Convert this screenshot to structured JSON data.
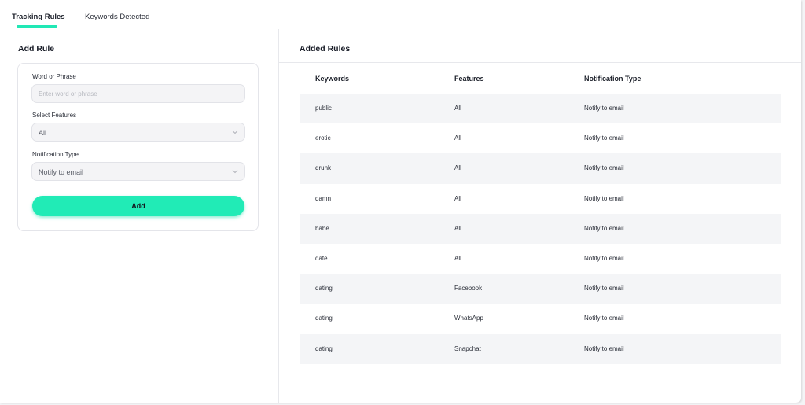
{
  "tabs": [
    {
      "label": "Tracking Rules",
      "active": true
    },
    {
      "label": "Keywords Detected",
      "active": false
    }
  ],
  "add_rule": {
    "title": "Add Rule",
    "word_label": "Word or Phrase",
    "word_placeholder": "Enter word or phrase",
    "word_value": "",
    "features_label": "Select Features",
    "features_value": "All",
    "notification_label": "Notification Type",
    "notification_value": "Notify to email",
    "add_button": "Add"
  },
  "added_rules": {
    "title": "Added Rules",
    "columns": [
      "Keywords",
      "Features",
      "Notification Type"
    ],
    "rows": [
      {
        "keyword": "public",
        "features": "All",
        "notification": "Notify to email"
      },
      {
        "keyword": "erotic",
        "features": "All",
        "notification": "Notify to email"
      },
      {
        "keyword": "drunk",
        "features": "All",
        "notification": "Notify to email"
      },
      {
        "keyword": "damn",
        "features": "All",
        "notification": "Notify to email"
      },
      {
        "keyword": "babe",
        "features": "All",
        "notification": "Notify to email"
      },
      {
        "keyword": "date",
        "features": "All",
        "notification": "Notify to email"
      },
      {
        "keyword": "dating",
        "features": "Facebook",
        "notification": "Notify to email"
      },
      {
        "keyword": "dating",
        "features": "WhatsApp",
        "notification": "Notify to email"
      },
      {
        "keyword": "dating",
        "features": "Snapchat",
        "notification": "Notify to email"
      }
    ]
  },
  "colors": {
    "accent": "#21ebb6",
    "stripe": "#f4f5f7",
    "border": "#e7e8ec"
  },
  "icons": {
    "select_chevron": "chevron-down-icon"
  }
}
